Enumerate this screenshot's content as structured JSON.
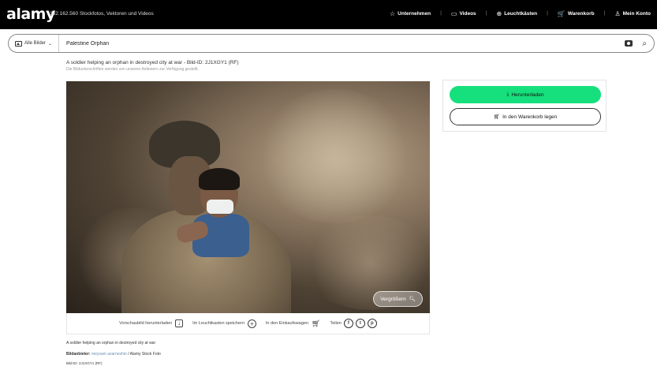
{
  "header": {
    "logo": "alamy",
    "tagline": "352.162.560 Stockfotos, Vektoren und Videos",
    "nav": [
      {
        "icon": "star-icon",
        "glyph": "☆",
        "label": "Unternehmen"
      },
      {
        "icon": "video-icon",
        "glyph": "▭",
        "label": "Videos"
      },
      {
        "icon": "lightbox-icon",
        "glyph": "⊕",
        "label": "Leuchtkästen"
      },
      {
        "icon": "cart-icon",
        "glyph": "🛒",
        "label": "Warenkorb"
      },
      {
        "icon": "user-icon",
        "glyph": "♙",
        "label": "Mein Konto"
      }
    ]
  },
  "search": {
    "category": "Alle Bilder",
    "query": "Palestine Orphan"
  },
  "image": {
    "title": "A soldier helping an orphan in destroyed city at war - Bild-ID: 2J1XGY1 (RF)",
    "subtitle": "Die Bildunterschriften werden von unseren Anbietern zur Verfügung gestellt.",
    "enlarge_label": "Vergrößern"
  },
  "actions": {
    "preview_label": "Vorschaubild herunterladen",
    "lightbox_label": "Im Leuchtkasten speichern",
    "cart_label": "In den Einkaufswagen",
    "share_label": "Teilen",
    "share_icons": [
      "f",
      "t",
      "p"
    ]
  },
  "details": {
    "caption": "A soldier helping an orphan in destroyed city at war",
    "credit_label": "Bildanbieter:",
    "credit_name": "meysam azarneshin",
    "credit_suffix": "/ Alamy Stock Foto",
    "image_id": "Bild-ID: 2J1XGY1 (RF)"
  },
  "purchase": {
    "download_label": "Herunterladen",
    "cart_label": "In den Warenkorb legen"
  },
  "colors": {
    "accent": "#16e07d",
    "topbar": "#000000"
  }
}
